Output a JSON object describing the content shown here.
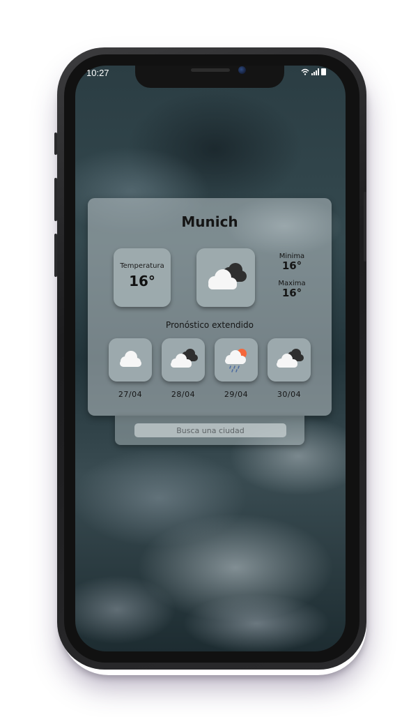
{
  "status_bar": {
    "time": "10:27"
  },
  "weather": {
    "city": "Munich",
    "current": {
      "label": "Temperatura",
      "value": "16°",
      "icon": "cloudy-icon"
    },
    "min": {
      "label": "Minima",
      "value": "16°"
    },
    "max": {
      "label": "Maxima",
      "value": "16°"
    },
    "forecast_title": "Pronóstico extendido",
    "forecast": [
      {
        "date": "27/04",
        "icon": "cloud-icon"
      },
      {
        "date": "28/04",
        "icon": "cloudy-icon"
      },
      {
        "date": "29/04",
        "icon": "sun-rain-icon"
      },
      {
        "date": "30/04",
        "icon": "cloudy-icon"
      }
    ]
  },
  "search": {
    "placeholder": "Busca una ciudad"
  },
  "colors": {
    "card": "#b9c3c6",
    "tile": "#a0acb0",
    "dark_cloud": "#2f2f2f",
    "light_cloud": "#f4f4f4",
    "sun": "#f5673a",
    "rain": "#4a6aa0"
  }
}
